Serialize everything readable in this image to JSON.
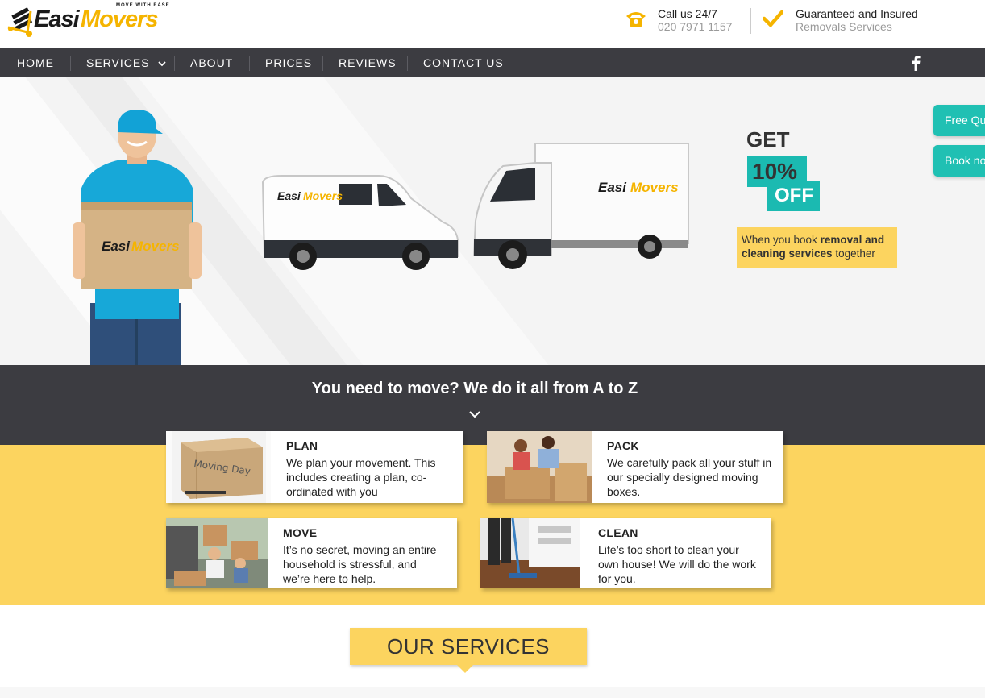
{
  "brand": {
    "name_part1": "Easi",
    "name_part2": "Movers",
    "tagline": "MOVE WITH EASE",
    "colors": {
      "yellow": "#f5b400",
      "dark": "#3c3c41",
      "teal": "#1bbab1",
      "light_yellow": "#fcd45f"
    }
  },
  "header": {
    "call_title": "Call us 24/7",
    "call_number": "020 7971 1157",
    "guarantee_title": "Guaranteed and Insured",
    "guarantee_sub": "Removals Services",
    "icons": [
      "phone-icon",
      "check-icon"
    ]
  },
  "nav": {
    "items": [
      {
        "label": "HOME"
      },
      {
        "label": "SERVICES"
      },
      {
        "label": "ABOUT"
      },
      {
        "label": "PRICES"
      },
      {
        "label": "REVIEWS"
      },
      {
        "label": "CONTACT US"
      }
    ],
    "icons": [
      "chevron-down-icon",
      "facebook-icon"
    ]
  },
  "hero": {
    "promo_get": "GET",
    "promo_pct": "10%",
    "promo_off": "OFF",
    "promo_note_1": "When you book ",
    "promo_note_bold": "removal and cleaning services",
    "promo_note_2": " together",
    "van_brand": "Easi Movers"
  },
  "side_buttons": {
    "quote": "Free Qu",
    "book": "Book no"
  },
  "band": {
    "title": "You need to move? We do it all from A to Z"
  },
  "cards": [
    {
      "title": "PLAN",
      "text": "We plan your movement. This includes creating a plan, co-ordinated with you",
      "img_text": "Moving Day"
    },
    {
      "title": "PACK",
      "text": "We carefully pack all your stuff in our specially designed moving boxes."
    },
    {
      "title": "MOVE",
      "text": "It’s no secret, moving an entire household is stressful, and we’re here to help."
    },
    {
      "title": "CLEAN",
      "text": "Life’s too short to clean your own house! We will do the work for you."
    }
  ],
  "services": {
    "title": "OUR SERVICES"
  }
}
